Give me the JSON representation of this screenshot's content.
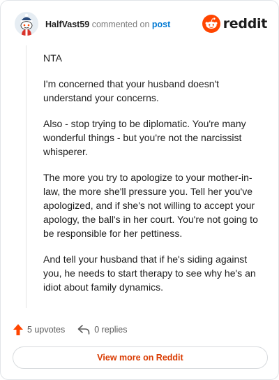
{
  "header": {
    "author": "HalfVast59",
    "action_text": "commented on",
    "post_link": "post",
    "logo_wordmark": "reddit",
    "logo_icon": "reddit-snoo-icon",
    "avatar_icon": "snoo-avatar-icon"
  },
  "comment": {
    "paragraphs": [
      "NTA",
      "I'm concerned that your husband doesn't understand your concerns.",
      "Also - stop trying to be diplomatic. You're many wonderful things - but you're not the narcissist whisperer.",
      "The more you try to apologize to your mother-in-law, the more she'll pressure you. Tell her you've apologized, and if she's not willing to accept your apology, the ball's in her court. You're not going to be responsible for her pettiness.",
      "And tell your husband that if he's siding against you, he needs to start therapy to see why he's an idiot about family dynamics."
    ]
  },
  "actions": {
    "upvotes_label": "5 upvotes",
    "replies_label": "0 replies",
    "upvote_icon": "upvote-arrow-icon",
    "reply_icon": "reply-arrow-icon"
  },
  "footer": {
    "view_more_label": "View more on Reddit"
  },
  "colors": {
    "brand_orange": "#ff4500",
    "link_blue": "#0079d3",
    "cta_text": "#d93a00"
  }
}
